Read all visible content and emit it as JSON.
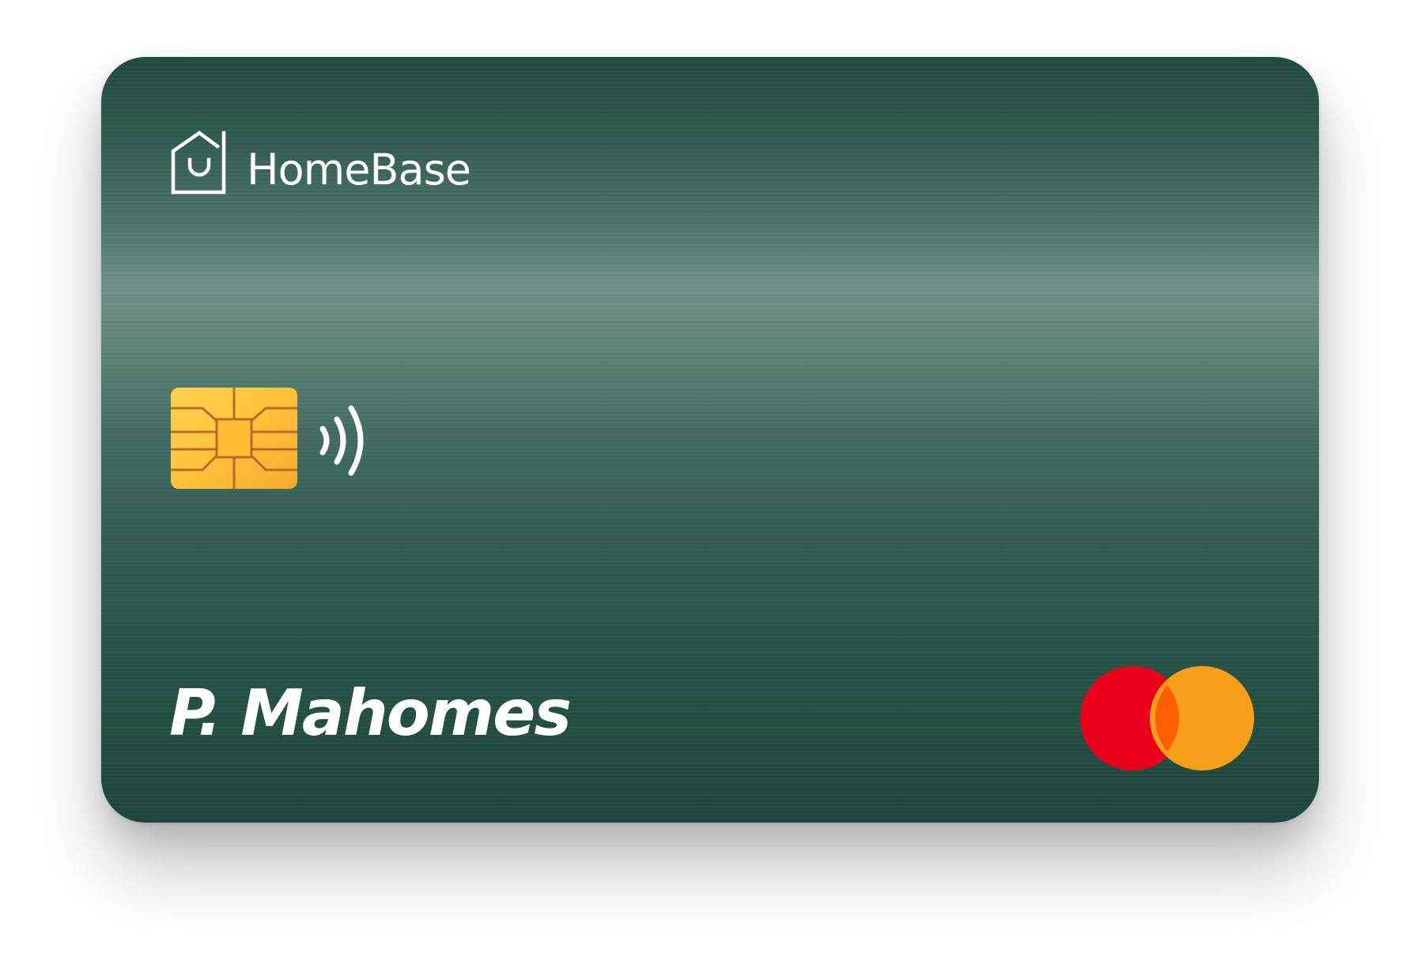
{
  "card": {
    "brand_name": "HomeBase",
    "cardholder_name": "P. Mahomes",
    "colors": {
      "card_base": "#2f5c4e",
      "chip_gold": "#ffc440",
      "network_red": "#eb001b",
      "network_orange": "#f79e1b",
      "network_overlap": "#ff5f00"
    },
    "icons": {
      "logo": "house-smile-icon",
      "chip": "emv-chip-icon",
      "contactless": "contactless-icon",
      "network": "mastercard-logo"
    }
  }
}
